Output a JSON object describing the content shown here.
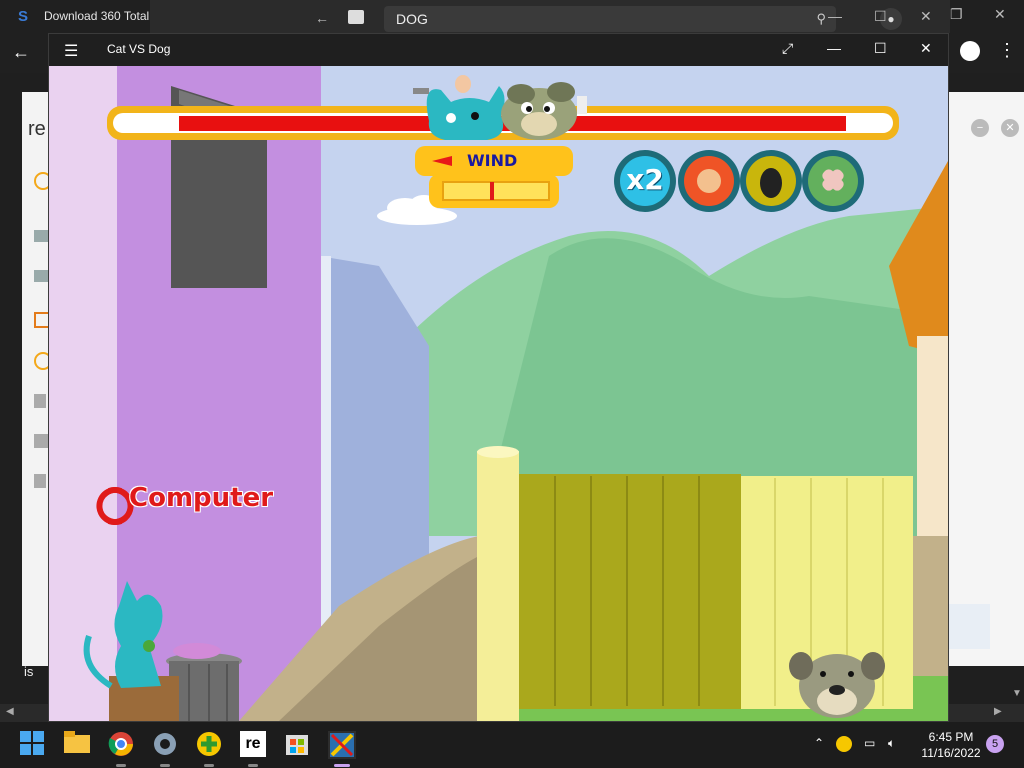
{
  "browser": {
    "title": "Download 360 Total",
    "address": "DOG",
    "page_text_fragment": "re",
    "left_fragment": "is"
  },
  "game_window": {
    "title": "Cat VS Dog"
  },
  "game": {
    "wind_label": "WIND",
    "turn_label": "Computer",
    "powerups": [
      "x2",
      "fist",
      "gas-mask",
      "bandage"
    ],
    "powerup_x2_text": "x2",
    "cat_health": 0.83,
    "dog_health": 0.9
  },
  "taskbar": {
    "time": "6:45 PM",
    "date": "11/16/2022",
    "notification_count": "5"
  },
  "colors": {
    "health_red": "#e81010",
    "health_frame": "#f2b41a",
    "wind_bg": "#ffc21b",
    "wind_text": "#1a1aa0",
    "computer_red": "#e01a1a",
    "sky": "#c7d4ee",
    "hill": "#8fd1a0"
  }
}
